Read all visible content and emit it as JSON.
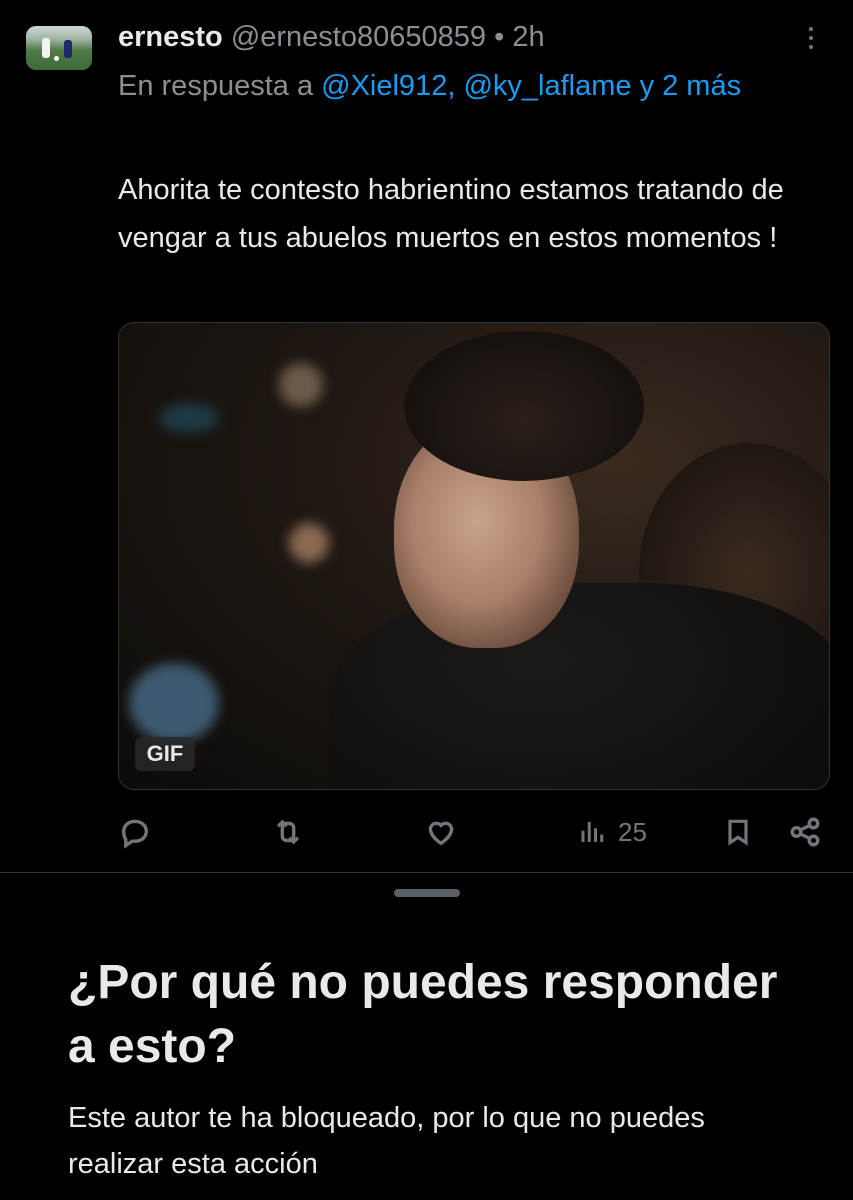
{
  "tweet": {
    "author_name": "ernesto",
    "author_handle": "@ernesto80650859",
    "separator": "•",
    "time": "2h",
    "reply_prefix": "En respuesta a",
    "mention_1": "@Xiel912,",
    "mention_2": "@ky_laflame y 2 más",
    "text": "Ahorita te contesto habrientino estamos tratando de vengar a tus abuelos muertos en estos momentos !",
    "media_badge": "GIF",
    "views": "25"
  },
  "icons": {
    "more": "more-vertical-icon",
    "reply": "reply-bubble-icon",
    "retweet": "retweet-icon",
    "like": "heart-icon",
    "views": "bar-chart-icon",
    "bookmark": "bookmark-icon",
    "share": "share-icon"
  },
  "sheet": {
    "title": "¿Por qué no puedes responder a esto?",
    "body": "Este autor te ha bloqueado, por lo que no puedes realizar esta acción"
  },
  "colors": {
    "background": "#000000",
    "text_primary": "#e7e9ea",
    "text_secondary": "#8b8f94",
    "link": "#1d9bf0",
    "icon": "#71767b"
  }
}
